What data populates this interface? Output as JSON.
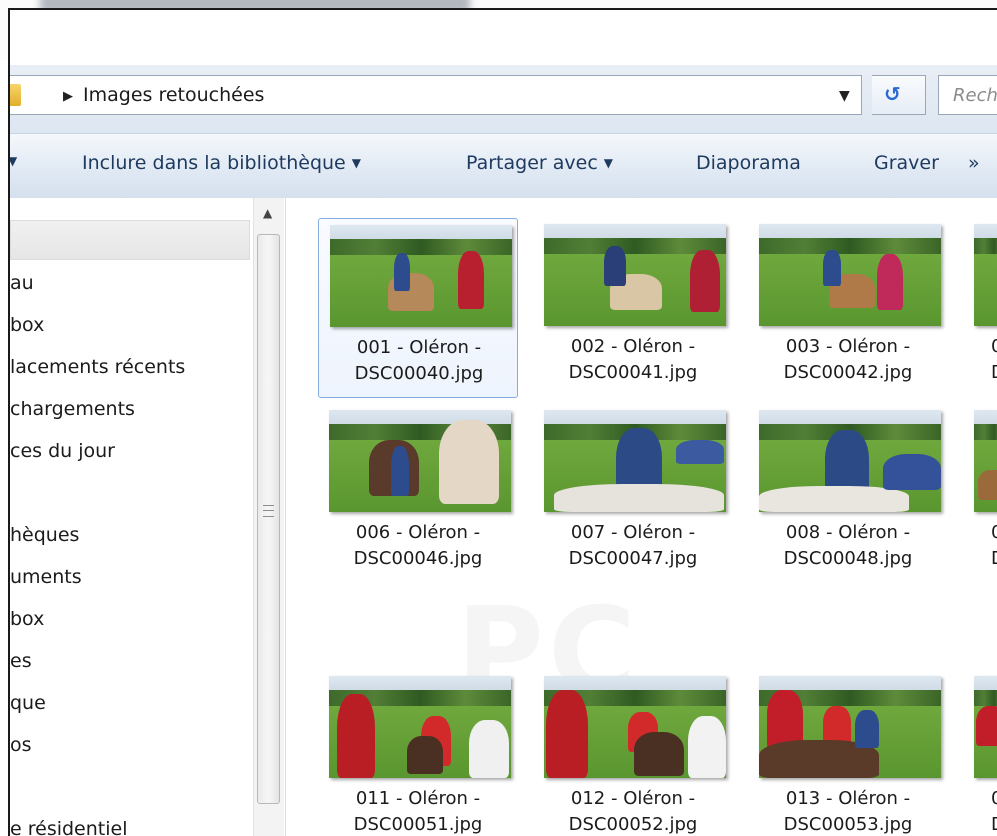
{
  "address": {
    "path": "Images retouchées",
    "search_placeholder": "Rech"
  },
  "toolbar": {
    "items": [
      {
        "label": "Inclure dans la bibliothèque",
        "caret": "▼"
      },
      {
        "label": "Partager avec",
        "caret": "▼"
      },
      {
        "label": "Diaporama",
        "caret": ""
      },
      {
        "label": "Graver",
        "caret": ""
      },
      {
        "label": "»",
        "caret": ""
      }
    ]
  },
  "nav": {
    "items": [
      "au",
      "box",
      "lacements récents",
      "chargements",
      "ces du jour",
      "hèques",
      "uments",
      "box",
      "es",
      "que",
      "os",
      "e résidentiel"
    ]
  },
  "files": [
    {
      "line1": "001 - Oléron -",
      "line2": "DSC00040.jpg"
    },
    {
      "line1": "002 - Oléron -",
      "line2": "DSC00041.jpg"
    },
    {
      "line1": "003 - Oléron -",
      "line2": "DSC00042.jpg"
    },
    {
      "line1": "0",
      "line2": "D"
    },
    {
      "line1": "006 - Oléron -",
      "line2": "DSC00046.jpg"
    },
    {
      "line1": "007 - Oléron -",
      "line2": "DSC00047.jpg"
    },
    {
      "line1": "008 - Oléron -",
      "line2": "DSC00048.jpg"
    },
    {
      "line1": "0",
      "line2": "D"
    },
    {
      "line1": "011 - Oléron -",
      "line2": "DSC00051.jpg"
    },
    {
      "line1": "012 - Oléron -",
      "line2": "DSC00052.jpg"
    },
    {
      "line1": "013 - Oléron -",
      "line2": "DSC00053.jpg"
    },
    {
      "line1": "0",
      "line2": "D"
    }
  ],
  "watermark": "PC"
}
